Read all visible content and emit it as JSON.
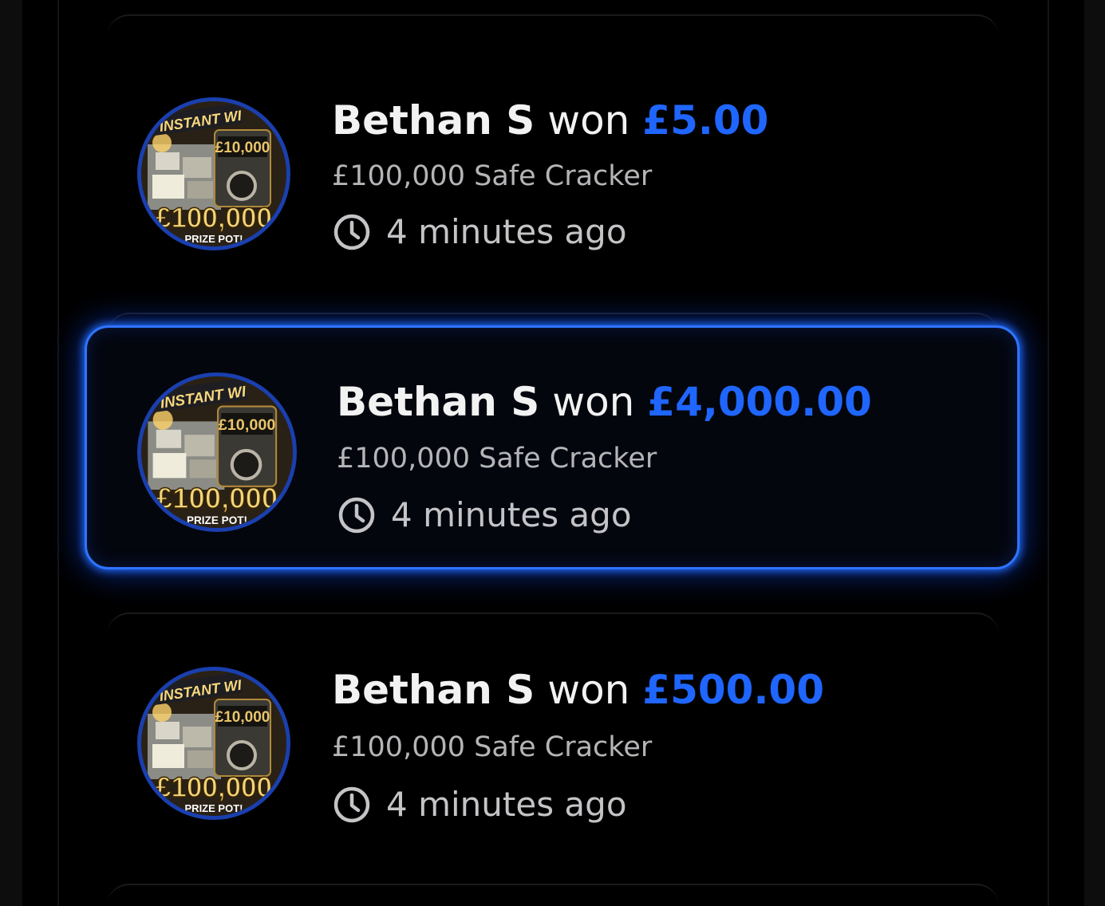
{
  "feed": {
    "items": [
      {
        "winner": "Bethan S",
        "verb": "won",
        "amount": "£5.00",
        "game": "£100,000 Safe Cracker",
        "time_ago": "4 minutes ago",
        "highlighted": false,
        "thumbnail": {
          "banner": "INSTANT WI",
          "top_prize": "£10,000",
          "pot": "£100,000",
          "pot_label": "PRIZE POT!"
        }
      },
      {
        "winner": "Bethan S",
        "verb": "won",
        "amount": "£4,000.00",
        "game": "£100,000 Safe Cracker",
        "time_ago": "4 minutes ago",
        "highlighted": true,
        "thumbnail": {
          "banner": "INSTANT WI",
          "top_prize": "£10,000",
          "pot": "£100,000",
          "pot_label": "PRIZE POT!"
        }
      },
      {
        "winner": "Bethan S",
        "verb": "won",
        "amount": "£500.00",
        "game": "£100,000 Safe Cracker",
        "time_ago": "4 minutes ago",
        "highlighted": false,
        "thumbnail": {
          "banner": "INSTANT WI",
          "top_prize": "£10,000",
          "pot": "£100,000",
          "pot_label": "PRIZE POT!"
        }
      }
    ]
  },
  "colors": {
    "background": "#000000",
    "amount_accent": "#1f66ff",
    "highlight_border": "#2f74ff",
    "thumbnail_ring": "#1a3fae"
  },
  "icons": {
    "time": "clock-icon",
    "thumbnail": "game-thumbnail-image"
  }
}
